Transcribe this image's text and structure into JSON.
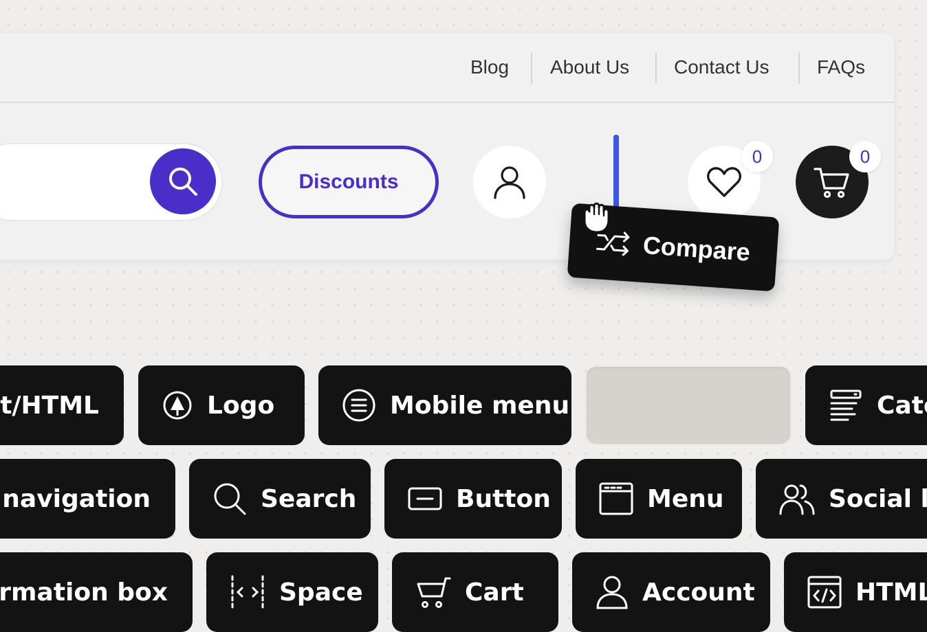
{
  "header": {
    "top_nav": [
      "Blog",
      "About Us",
      "Contact Us",
      "FAQs"
    ],
    "discounts_label": "Discounts",
    "wishlist_count": "0",
    "cart_count": "0",
    "drag_item_label": "Compare"
  },
  "widgets": {
    "row1": [
      "xt/HTML",
      "Logo",
      "Mobile menu",
      "",
      "Cate"
    ],
    "row2": [
      "ky navigation",
      "Search",
      "Button",
      "Menu",
      "Social lir"
    ],
    "row3": [
      "formation box",
      "Space",
      "Cart",
      "Account",
      "HTML"
    ]
  },
  "colors": {
    "accent": "#4a2ec9",
    "drop_indicator": "#3d55e6",
    "tile_bg": "#131313",
    "panel_bg": "#f1f1f1",
    "canvas_bg": "#efeeed"
  },
  "icons": {
    "search_button": "search-icon",
    "account": "user-icon",
    "wishlist": "heart-icon",
    "cart": "cart-icon",
    "compare": "shuffle-icon",
    "cursor": "grab-hand-icon"
  }
}
